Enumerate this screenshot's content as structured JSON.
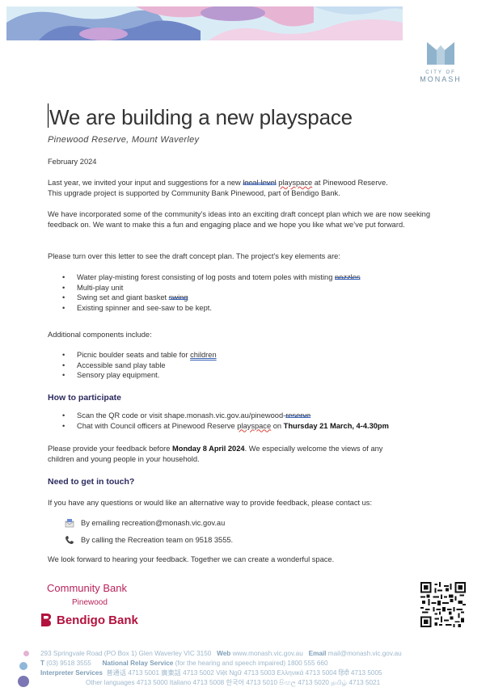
{
  "logo": {
    "city": "CITY OF",
    "name": "MONASH"
  },
  "title": "We are building a new playspace",
  "subtitle": "Pinewood Reserve, Mount Waverley",
  "date": "February 2024",
  "para1_a": "Last year, we invited your input and suggestions for a new ",
  "para1_local": "local-level",
  "para1_play": "playspace",
  "para1_b": " at Pinewood Reserve.",
  "para1_c": "This upgrade project is supported by Community Bank Pinewood, part of Bendigo Bank.",
  "para2": "We have incorporated some of the community’s ideas into an exciting draft concept plan which we are now seeking feedback on. We want to make this a fun and engaging place and we hope you like what we’ve put forward.",
  "para3": "Please turn over this letter to see the draft concept plan. The project’s key elements are:",
  "key_elements": {
    "item1_a": "Water play-misting forest consisting of log posts and totem poles with misting ",
    "item1_b": "nozzles",
    "item2": "Multi-play unit",
    "item3_a": "Swing set and giant basket ",
    "item3_b": "swing",
    "item4": "Existing spinner and see-saw to be kept."
  },
  "additional_intro": "Additional components include:",
  "additional": {
    "item1_a": "Picnic boulder seats and table for ",
    "item1_b": "children",
    "item2": "Accessible sand play table",
    "item3": "Sensory play equipment."
  },
  "how_heading": "How to participate",
  "participate": {
    "item1_a": "Scan the QR code or visit shape.monash.vic.gov.au/pinewood-",
    "item1_b": "reserve",
    "item2_a": "Chat with Council officers at Pinewood Reserve ",
    "item2_b": "playspace",
    "item2_c": " on ",
    "item2_d": "Thursday 21 March, 4-4.30pm"
  },
  "feedback_a": "Please provide your feedback before ",
  "feedback_date": "Monday 8 April 2024",
  "feedback_b": ". We especially welcome the views of any",
  "feedback_c": "children and young people in your household.",
  "touch_heading": "Need to get in touch?",
  "touch_intro": "If you have any questions or would like an alternative way to provide feedback, please contact us:",
  "contact_email": "By emailing recreation@monash.vic.gov.au",
  "contact_phone": "By calling the Recreation team on 9518 3555.",
  "closing": "We look forward to hearing your feedback. Together we can create a wonderful space.",
  "sponsor": {
    "line1": "Community Bank",
    "line2": "Pinewood",
    "bank": "Bendigo Bank"
  },
  "footer": {
    "address": "293 Springvale Road (PO Box 1) Glen Waverley VIC 3150",
    "web_label": "Web",
    "web": "www.monash.vic.gov.au",
    "email_label": "Email",
    "email": "mail@monash.vic.gov.au",
    "t_label": "T",
    "phone": "(03) 9518 3555",
    "nrs_label": "National Relay Service",
    "nrs": "(for the hearing and speech impaired)  1800 555 660",
    "interp_label": "Interpreter Services",
    "line3": "普通话  4713 5001   廣東話  4713 5002   Việt Ngữ  4713 5003   Ελληνικά  4713 5004   हिंदी  4713 5005",
    "line4": "Other languages  4713 5000   Italiano  4713 5008   한국어  4713 5010   සිංහල  4713 5020   தமிழ்  4713 5021"
  },
  "colors": {
    "heading": "#2b2a5e",
    "bank": "#b3123e",
    "footer": "#9fb8cc"
  }
}
